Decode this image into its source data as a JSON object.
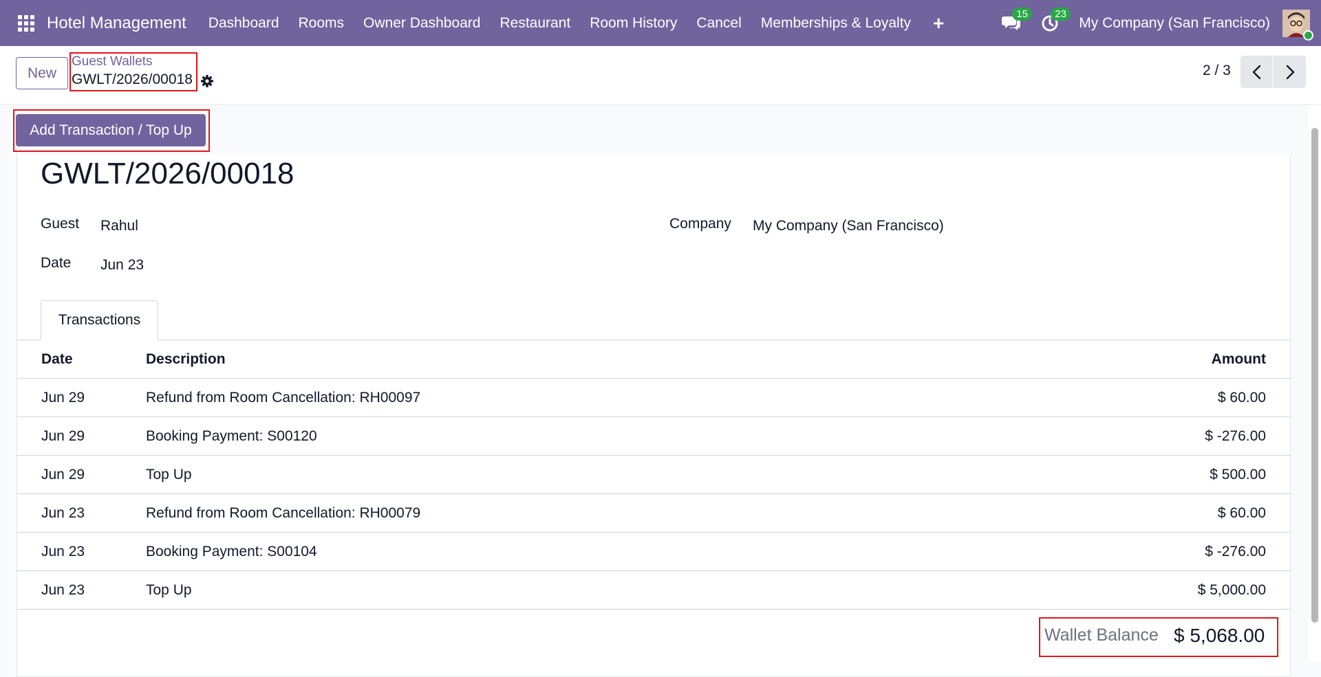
{
  "navbar": {
    "app_title": "Hotel Management",
    "menu": [
      "Dashboard",
      "Rooms",
      "Owner Dashboard",
      "Restaurant",
      "Room History",
      "Cancel",
      "Memberships & Loyalty"
    ],
    "plus": "+",
    "messages_badge": "15",
    "activities_badge": "23",
    "company": "My Company (San Francisco)",
    "color": "#71639e"
  },
  "control_panel": {
    "new_label": "New",
    "breadcrumb_parent": "Guest Wallets",
    "breadcrumb_current": "GWLT/2026/00018",
    "pager": "2 / 3"
  },
  "statusbar": {
    "button_label": "Add Transaction / Top Up"
  },
  "record": {
    "title": "GWLT/2026/00018",
    "guest_label": "Guest",
    "guest_value": "Rahul",
    "date_label": "Date",
    "date_value": "Jun 23",
    "company_label": "Company",
    "company_value": "My Company (San Francisco)"
  },
  "tabs": {
    "transactions": "Transactions"
  },
  "table": {
    "headers": {
      "date": "Date",
      "description": "Description",
      "amount": "Amount"
    },
    "rows": [
      {
        "date": "Jun 29",
        "description": "Refund from Room Cancellation: RH00097",
        "amount": "$ 60.00"
      },
      {
        "date": "Jun 29",
        "description": "Booking Payment: S00120",
        "amount": "$ -276.00"
      },
      {
        "date": "Jun 29",
        "description": "Top Up",
        "amount": "$ 500.00"
      },
      {
        "date": "Jun 23",
        "description": "Refund from Room Cancellation: RH00079",
        "amount": "$ 60.00"
      },
      {
        "date": "Jun 23",
        "description": "Booking Payment: S00104",
        "amount": "$ -276.00"
      },
      {
        "date": "Jun 23",
        "description": "Top Up",
        "amount": "$ 5,000.00"
      }
    ]
  },
  "balance": {
    "label": "Wallet Balance",
    "value": "$ 5,068.00"
  }
}
